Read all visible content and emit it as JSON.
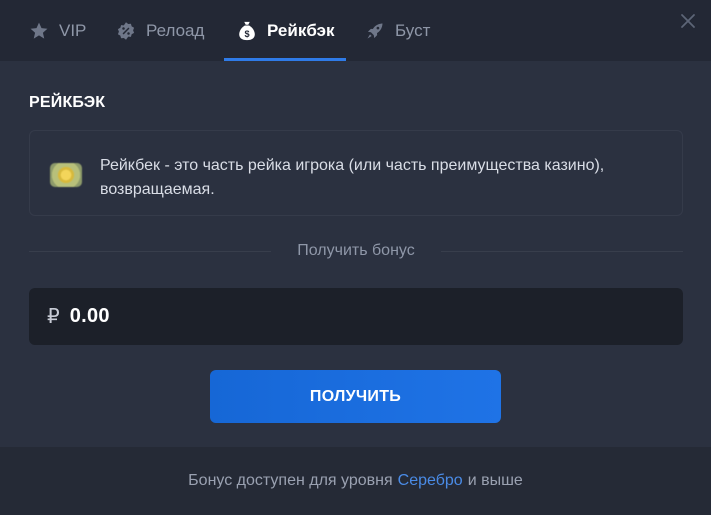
{
  "tabs": [
    {
      "label": "VIP",
      "icon": "star-icon"
    },
    {
      "label": "Релоад",
      "icon": "reload-badge-icon"
    },
    {
      "label": "Рейкбэк",
      "icon": "money-bag-icon",
      "active": true
    },
    {
      "label": "Буст",
      "icon": "rocket-icon"
    }
  ],
  "section": {
    "title": "РЕЙКБЭК",
    "info_text": "Рейкбек - это часть рейка игрока (или часть преимущества казино), возвращаемая."
  },
  "divider_label": "Получить бонус",
  "amount": {
    "currency_symbol": "₽",
    "value": "0.00"
  },
  "button_label": "ПОЛУЧИТЬ",
  "footer": {
    "prefix": "Бонус доступен для уровня",
    "level": "Серебро",
    "suffix": "и выше"
  },
  "colors": {
    "accent": "#2f7be8",
    "link": "#4a8be6",
    "background": "#2b3140"
  }
}
